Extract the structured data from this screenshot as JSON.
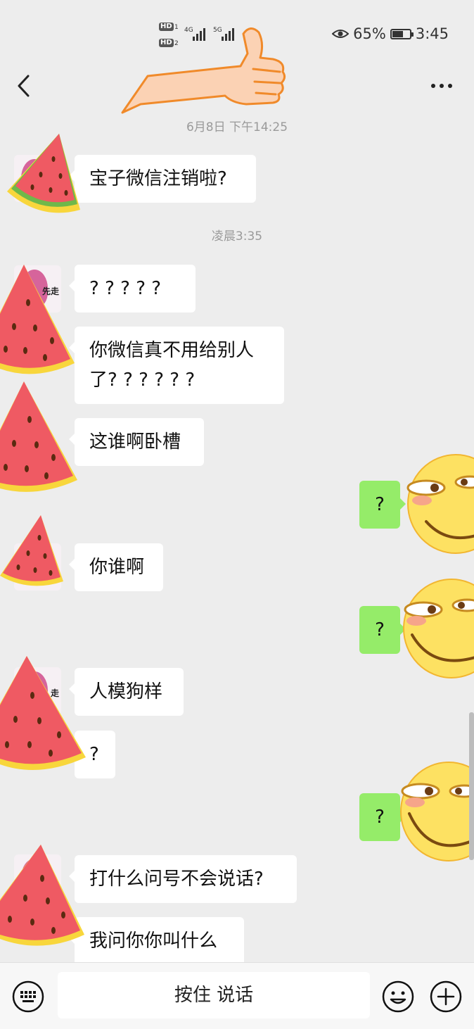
{
  "status_bar": {
    "hd1": "HD",
    "hd1_sub": "1",
    "hd2": "HD",
    "hd2_sub": "2",
    "net1": "4G",
    "net2": "5G",
    "battery_percent": "65%",
    "battery_level": 0.65,
    "time": "3:45"
  },
  "header": {
    "back_icon": "chevron-left-icon",
    "more_icon": "more-dots-icon"
  },
  "timestamps": [
    "6月8日 下午14:25",
    "凌晨3:35"
  ],
  "messages": [
    {
      "from": "other",
      "text": "宝子微信注销啦?"
    },
    {
      "from": "other",
      "text": "? ? ? ? ?"
    },
    {
      "from": "other",
      "text": "你微信真不用给别人\n了? ? ? ? ? ?"
    },
    {
      "from": "other",
      "text": "这谁啊卧槽"
    },
    {
      "from": "me",
      "text": "?"
    },
    {
      "from": "other",
      "text": "你谁啊"
    },
    {
      "from": "me",
      "text": "?"
    },
    {
      "from": "other",
      "text": "人模狗样"
    },
    {
      "from": "other",
      "text": "?"
    },
    {
      "from": "me",
      "text": "?"
    },
    {
      "from": "other",
      "text": "打什么问号不会说话?"
    },
    {
      "from": "other",
      "text": "我问你你叫什么"
    }
  ],
  "avatar_tags": [
    "先走",
    "走"
  ],
  "input_bar": {
    "keyboard_icon": "keyboard-icon",
    "voice_label": "按住 说话",
    "emoji_icon": "smiley-icon",
    "plus_icon": "plus-icon"
  },
  "colors": {
    "background": "#ededed",
    "my_bubble": "#95ec69",
    "other_bubble": "#ffffff",
    "timestamp": "#9a9a9a"
  }
}
